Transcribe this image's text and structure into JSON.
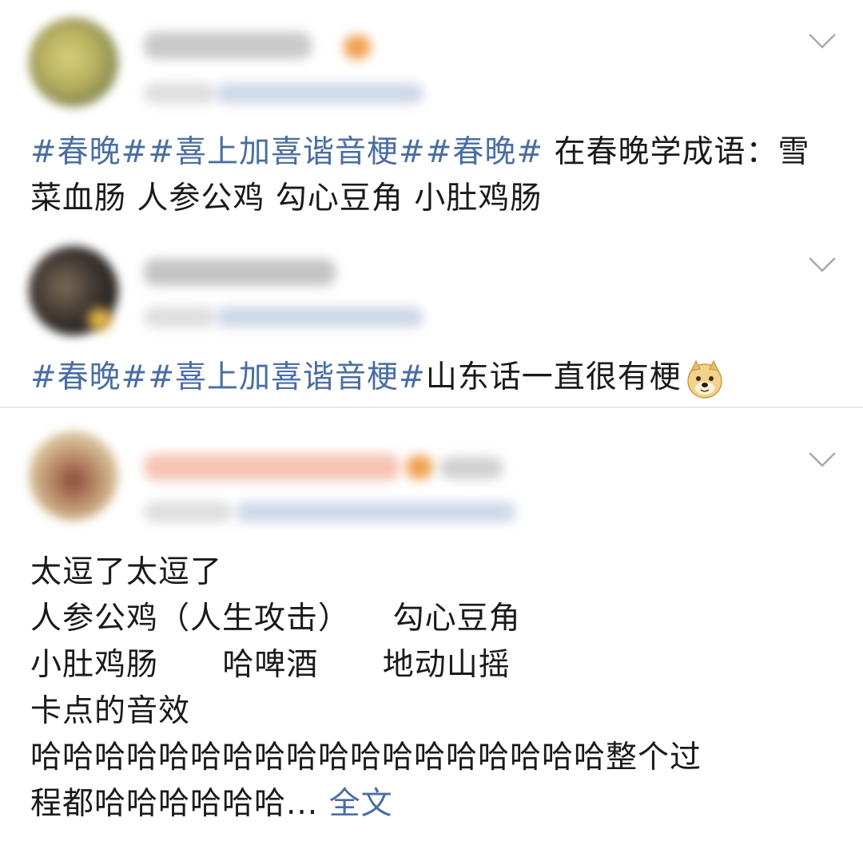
{
  "posts": [
    {
      "topics": [
        "#春晚#",
        "#喜上加喜谐音梗#",
        "#春晚#"
      ],
      "text_line1": " 在春晚学成语：雪",
      "text_line2": "菜血肠 人参公鸡 勾心豆角 小肚鸡肠"
    },
    {
      "topics": [
        "#春晚#",
        "#喜上加喜谐音梗#"
      ],
      "text": "山东话一直很有梗",
      "emoji": "doge-emoji"
    },
    {
      "lines": [
        "太逗了太逗了",
        "人参公鸡（人生攻击）    勾心豆角",
        "小肚鸡肠      哈啤酒      地动山摇",
        "卡点的音效",
        "哈哈哈哈哈哈哈哈哈哈哈哈哈哈哈哈哈哈整个过",
        "程都哈哈哈哈哈哈..."
      ],
      "more_label": "全文"
    }
  ],
  "colors": {
    "topic": "#4a6ea3",
    "divider": "#ececec"
  },
  "icons": [
    "chevron-down-icon",
    "doge-emoji"
  ]
}
